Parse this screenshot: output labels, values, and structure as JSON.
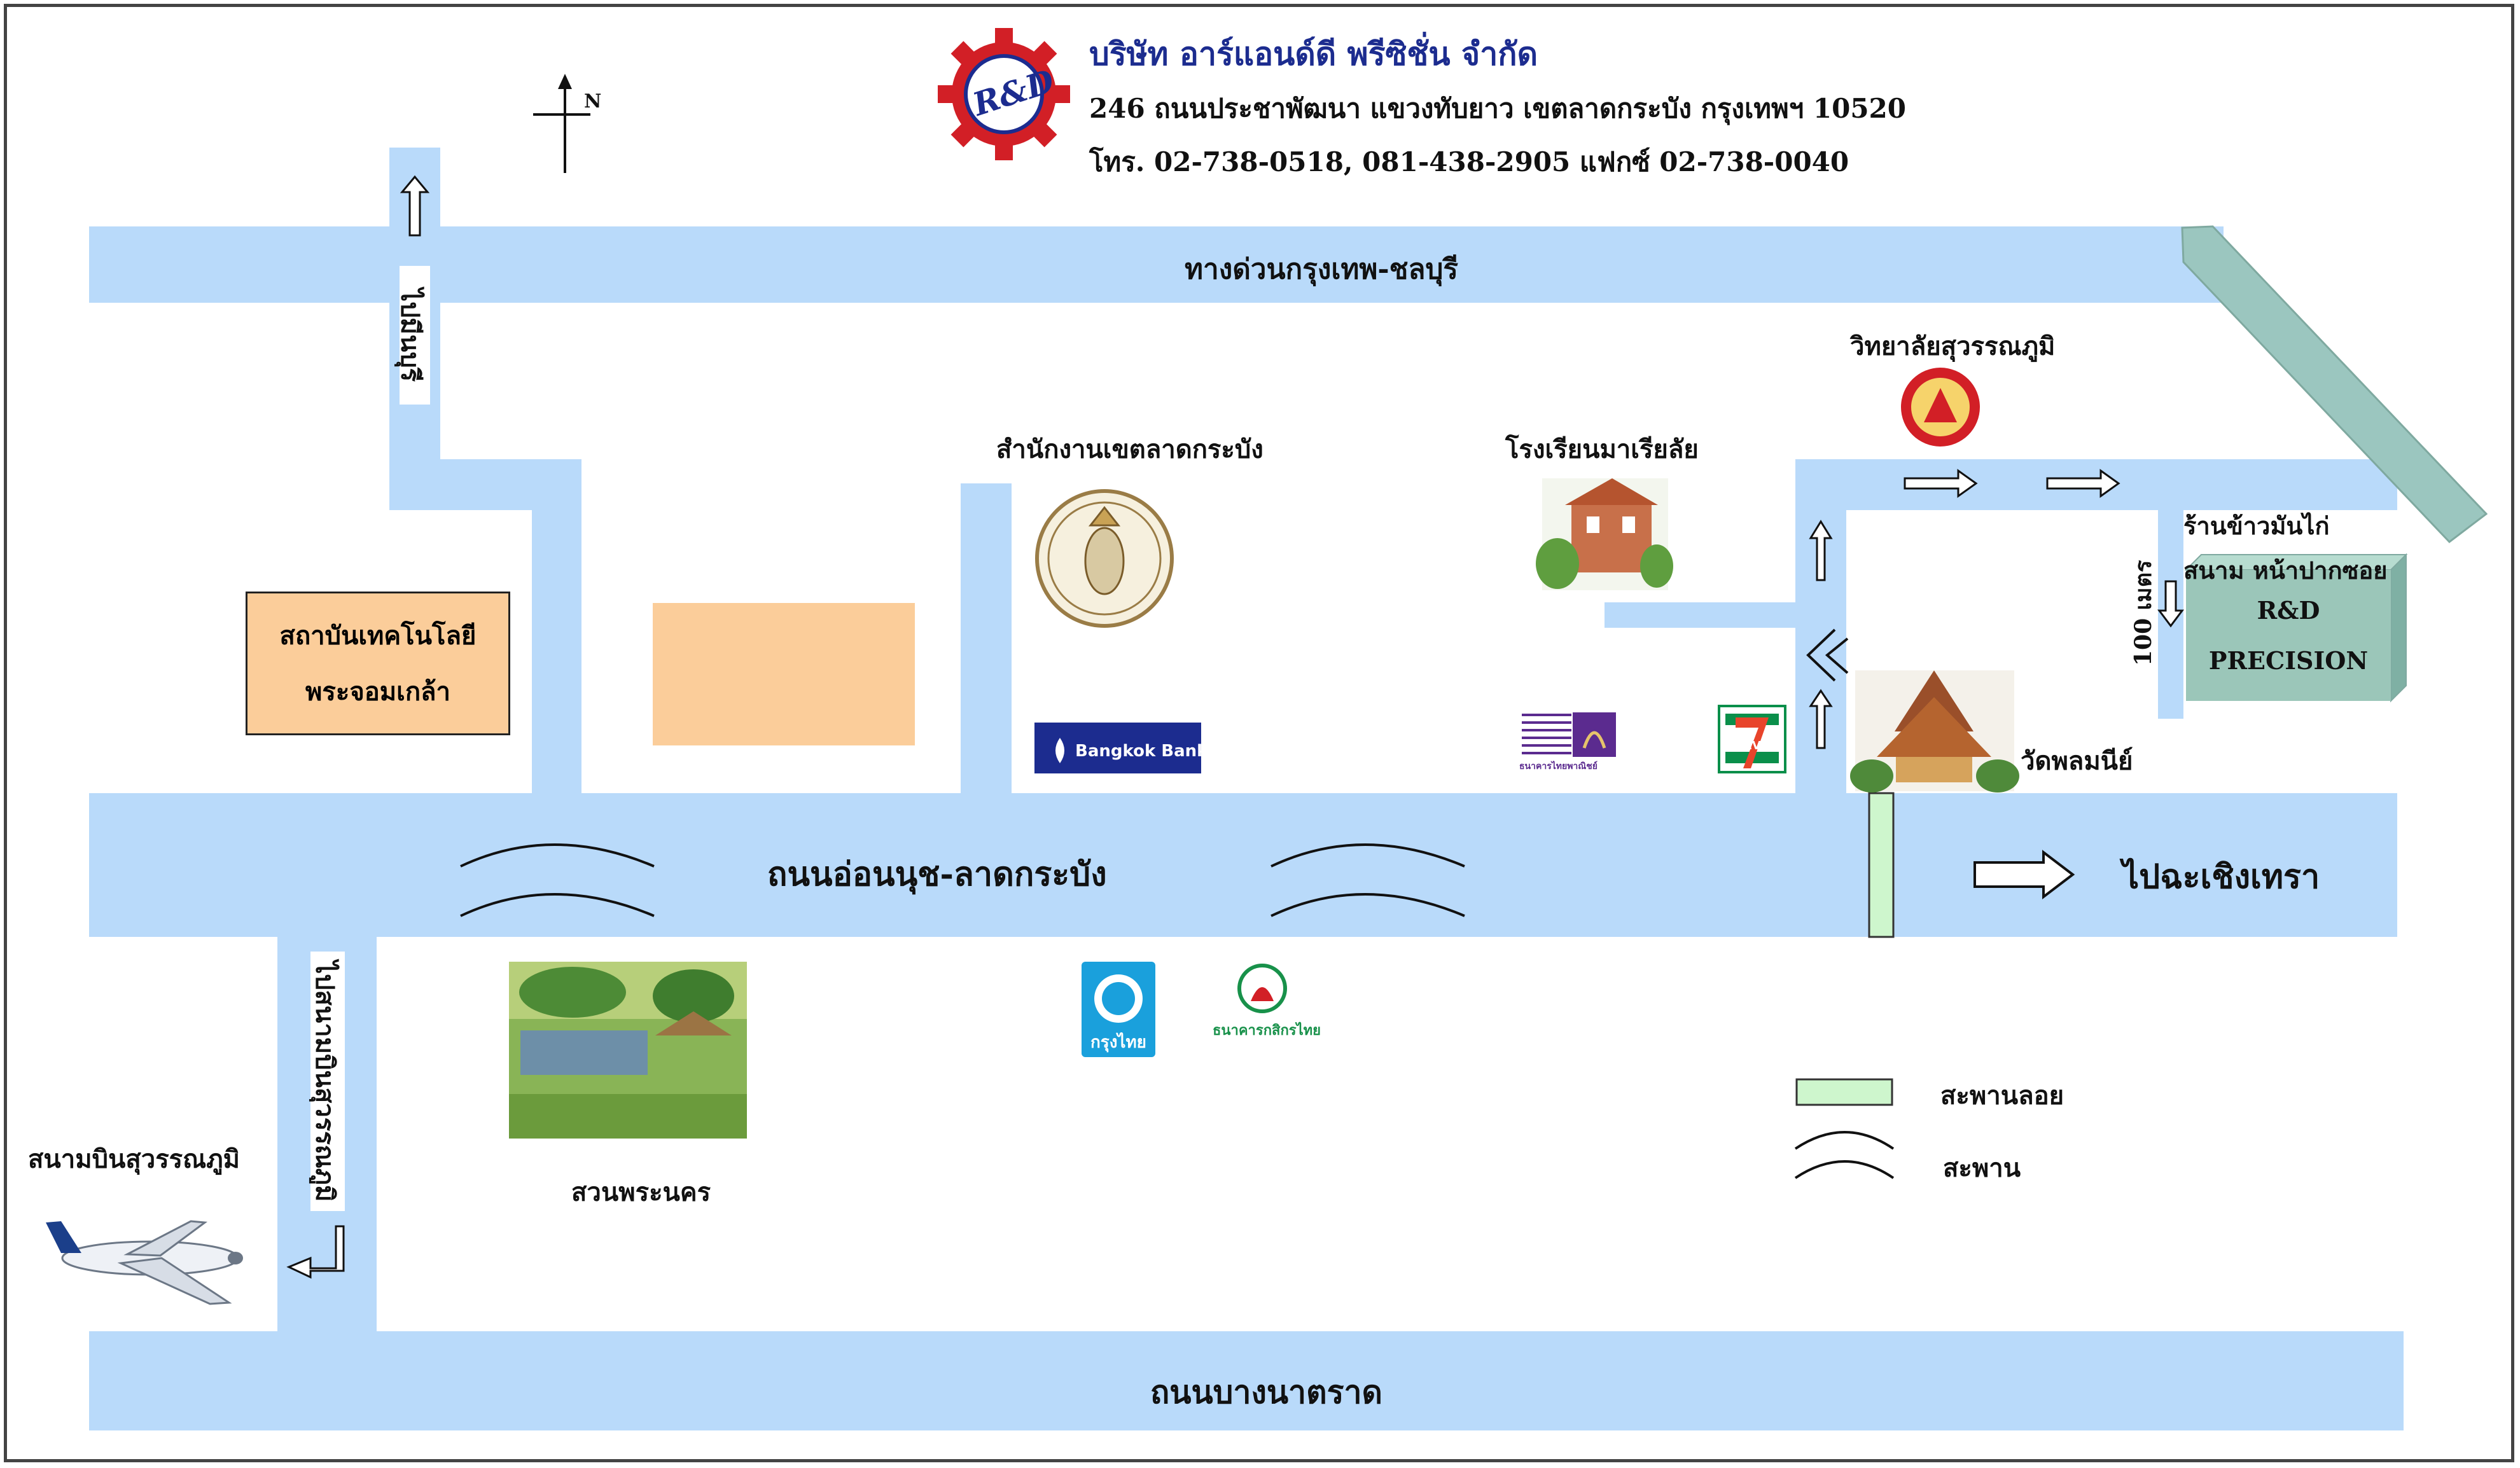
{
  "header": {
    "company_name": "บริษัท อาร์แอนด์ดี พรีซิชั่น จำกัด",
    "address": "246 ถนนประชาพัฒนา แขวงทับยาว เขตลาดกระบัง กรุงเทพฯ 10520",
    "phone": "โทร. 02-738-0518, 081-438-2905 แฟกซ์ 02-738-0040",
    "logo_text": "R&D",
    "north_label": "N"
  },
  "roads": {
    "expressway": "ทางด่วนกรุงเทพ-ชลบุรี",
    "on_nut": "ถนนอ่อนนุช-ลาดกระบัง",
    "bang_na_trat": "ถนนบางนาตราด",
    "to_minburi": "ไปมีนบุรี",
    "to_airport": "ไปสนามบินสุวรรณภูมิ",
    "to_chachoengsao": "ไปฉะเชิงเทรา",
    "distance": "100 เมตร"
  },
  "places": {
    "kmitl_line1": "สถาบันเทคโนโลยี",
    "kmitl_line2": "พระจอมเกล้า",
    "district_office": "สำนักงานเขตลาดกระบัง",
    "marialai_school": "โรงเรียนมาเรียลัย",
    "suvarnabhumi_college": "วิทยาลัยสุวรรณภูมิ",
    "chicken_rice_line1": "ร้านข้าวมันไก่",
    "chicken_rice_line2": "สนาม หน้าปากซอย",
    "wat": "วัดพลมนีย์",
    "park": "สวนพระนคร",
    "airport": "สนามบินสุวรรณภูมิ",
    "rd_line1": "R&D",
    "rd_line2": "PRECISION"
  },
  "logos": {
    "bangkok_bank": "Bangkok Bank",
    "krungthai": "กรุงไทย",
    "kasikorn": "ธนาคารกสิกรไทย",
    "seven_eleven": "ELEVEn",
    "scb": "ธนาคารไทยพาณิชย์"
  },
  "legend": {
    "floating_bridge": "สะพานลอย",
    "bridge": "สะพาน"
  },
  "colors": {
    "road": "#b9dafa",
    "kmitl_box": "#fbcd9a",
    "rd_box": "#9bc6b9",
    "floating_bridge": "#cef6cd",
    "expressway_ramp": "#9bc6bf",
    "logo_red": "#d21f26",
    "logo_blue": "#1c2c8f"
  }
}
